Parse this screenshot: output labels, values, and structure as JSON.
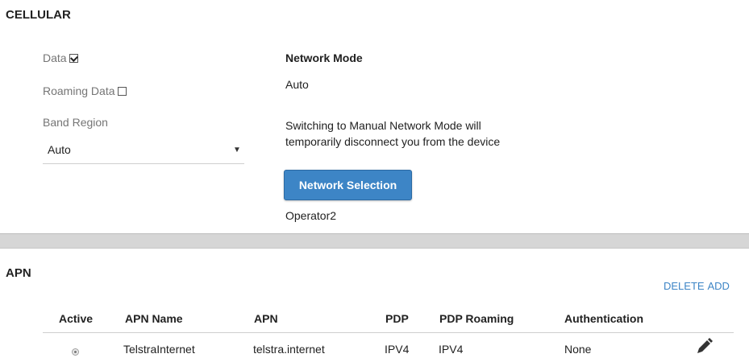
{
  "cellular": {
    "title": "CELLULAR",
    "data_label": "Data",
    "data_checked": true,
    "roaming_label": "Roaming Data",
    "roaming_checked": false,
    "band_region_label": "Band Region",
    "band_region_value": "Auto"
  },
  "network": {
    "mode_label": "Network Mode",
    "mode_value": "Auto",
    "warning": "Switching to Manual Network Mode will temporarily disconnect you from the device",
    "selection_button": "Network Selection",
    "operator": "Operator2"
  },
  "apn": {
    "title": "APN",
    "delete_label": "DELETE",
    "add_label": "ADD",
    "columns": [
      "Active",
      "APN Name",
      "APN",
      "PDP",
      "PDP Roaming",
      "Authentication"
    ],
    "rows": [
      {
        "active": true,
        "apn_name": "TelstraInternet",
        "apn": "telstra.internet",
        "pdp": "IPV4",
        "pdp_roaming": "IPV4",
        "authentication": "None"
      }
    ]
  },
  "icons": {
    "edit": "pencil-icon",
    "dropdown": "caret-down-icon",
    "radio": "radio-icon"
  },
  "colors": {
    "accent": "#3d85c6",
    "divider": "#d6d6d6"
  }
}
